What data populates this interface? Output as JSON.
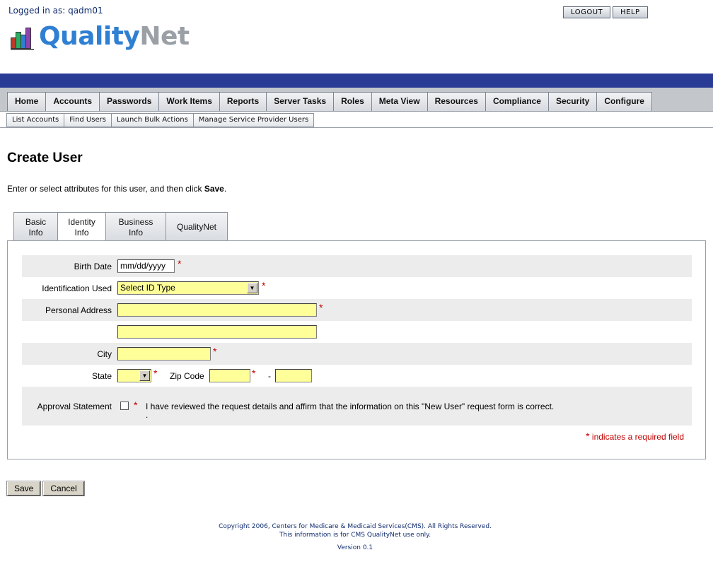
{
  "header": {
    "logged_in": "Logged in as: qadm01",
    "logout_label": "LOGOUT",
    "help_label": "HELP",
    "logo_quality": "Quality",
    "logo_net": "Net"
  },
  "main_nav": {
    "active": "Accounts",
    "items": [
      "Home",
      "Accounts",
      "Passwords",
      "Work Items",
      "Reports",
      "Server Tasks",
      "Roles",
      "Meta View",
      "Resources",
      "Compliance",
      "Security",
      "Configure"
    ]
  },
  "sub_nav": {
    "items": [
      "List Accounts",
      "Find Users",
      "Launch Bulk Actions",
      "Manage Service Provider Users"
    ]
  },
  "page": {
    "title": "Create User",
    "instructions_prefix": "Enter or select attributes for this user, and then click ",
    "instructions_bold": "Save",
    "instructions_suffix": "."
  },
  "form_tabs": [
    {
      "line1": "Basic",
      "line2": "Info"
    },
    {
      "line1": "Identity",
      "line2": "Info"
    },
    {
      "line1": "Business",
      "line2": "Info"
    },
    {
      "line1": "QualityNet",
      "line2": ""
    }
  ],
  "form": {
    "birth_date_label": "Birth Date",
    "birth_date_value": "mm/dd/yyyy",
    "id_used_label": "Identification Used",
    "id_used_value": "Select ID Type",
    "address_label": "Personal Address",
    "address_line1": "",
    "address_line2": "",
    "city_label": "City",
    "city_value": "",
    "state_label": "State",
    "state_value": "",
    "zip_label": "Zip Code",
    "zip_value": "",
    "zip_ext_value": "",
    "zip_dash": "-",
    "approval_label": "Approval Statement",
    "approval_text": "I have reviewed the request details and affirm that the information on this \"New User\" request form is correct.",
    "approval_dot": ".",
    "required_marker": "*",
    "required_note": "indicates a required field"
  },
  "actions": {
    "save_label": "Save",
    "cancel_label": "Cancel"
  },
  "footer": {
    "copyright": "Copyright 2006, Centers for Medicare & Medicaid Services(CMS). All Rights Reserved.",
    "usage": "This information is for CMS QualityNet use only.",
    "version": "Version 0.1"
  },
  "colors": {
    "band": "#2a3b96",
    "required": "#c00000",
    "field_fill": "#ffff99",
    "logo_blue": "#2f7fd3",
    "logo_gray": "#9aa0a6"
  },
  "icons": [
    "qualitynet-logo-icon",
    "select-dropdown-arrow-icon"
  ]
}
